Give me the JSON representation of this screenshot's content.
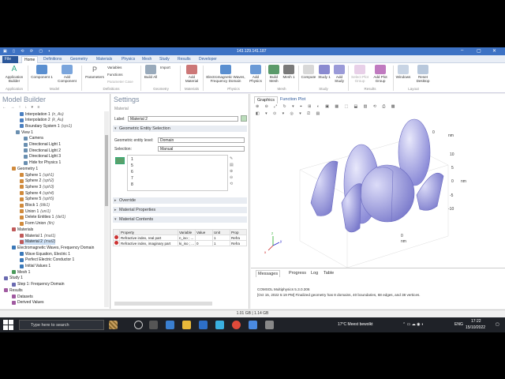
{
  "titlebar": {
    "title": "143.129.141.187"
  },
  "menu_tabs": [
    "File",
    "Home",
    "Definitions",
    "Geometry",
    "Materials",
    "Physics",
    "Mesh",
    "Study",
    "Results",
    "Developer"
  ],
  "ribbon": {
    "buttons": [
      "Application Builder",
      "Component 1",
      "Add Component",
      "Parameters",
      "Build All",
      "Add Material",
      "Electromagnetic Waves, Frequency Domain",
      "Add Physics",
      "Build Mesh",
      "Mesh 1",
      "Compute",
      "Study 1",
      "Add Study",
      "Select Plot Group",
      "Add Plot Group",
      "Windows",
      "Reset Desktop"
    ],
    "small": [
      "Variables",
      "Functions",
      "Parameter Case",
      "Import"
    ],
    "groups": [
      "Application",
      "Model",
      "Definitions",
      "Geometry",
      "Materials",
      "Physics",
      "Mesh",
      "Study",
      "Results",
      "Layout"
    ]
  },
  "model_builder": {
    "title": "Model Builder",
    "tree": [
      {
        "label": "Interpolation 1",
        "tag": "(n_Au)",
        "indent": 5,
        "color": "#4a7fc0"
      },
      {
        "label": "Interpolation 2",
        "tag": "(k_Au)",
        "indent": 5,
        "color": "#4a7fc0"
      },
      {
        "label": "Boundary System 1",
        "tag": "(sys1)",
        "indent": 5,
        "color": "#4a7fc0"
      },
      {
        "label": "View 1",
        "tag": "",
        "indent": 4,
        "color": "#6a8fb0"
      },
      {
        "label": "Camera",
        "tag": "",
        "indent": 6,
        "color": "#6a8fb0"
      },
      {
        "label": "Directional Light 1",
        "tag": "",
        "indent": 6,
        "color": "#6a8fb0"
      },
      {
        "label": "Directional Light 2",
        "tag": "",
        "indent": 6,
        "color": "#6a8fb0"
      },
      {
        "label": "Directional Light 3",
        "tag": "",
        "indent": 6,
        "color": "#6a8fb0"
      },
      {
        "label": "Hide for Physics 1",
        "tag": "",
        "indent": 6,
        "color": "#6a8fb0"
      },
      {
        "label": "Geometry 1",
        "tag": "",
        "indent": 3,
        "color": "#d08a3c"
      },
      {
        "label": "Sphere 1",
        "tag": "(sph1)",
        "indent": 5,
        "color": "#d08a3c"
      },
      {
        "label": "Sphere 2",
        "tag": "(sph2)",
        "indent": 5,
        "color": "#d08a3c"
      },
      {
        "label": "Sphere 3",
        "tag": "(sph3)",
        "indent": 5,
        "color": "#d08a3c"
      },
      {
        "label": "Sphere 4",
        "tag": "(sph4)",
        "indent": 5,
        "color": "#d08a3c"
      },
      {
        "label": "Sphere 5",
        "tag": "(sph5)",
        "indent": 5,
        "color": "#d08a3c"
      },
      {
        "label": "Block 1",
        "tag": "(blk1)",
        "indent": 5,
        "color": "#d08a3c"
      },
      {
        "label": "Union 1",
        "tag": "(uni1)",
        "indent": 5,
        "color": "#d08a3c"
      },
      {
        "label": "Delete Entities 1",
        "tag": "(del1)",
        "indent": 5,
        "color": "#d08a3c"
      },
      {
        "label": "Form Union",
        "tag": "(fin)",
        "indent": 5,
        "color": "#d08a3c"
      },
      {
        "label": "Materials",
        "tag": "",
        "indent": 3,
        "color": "#c05a5a"
      },
      {
        "label": "Material 1",
        "tag": "(mat1)",
        "indent": 5,
        "color": "#c05a5a"
      },
      {
        "label": "Material 2",
        "tag": "(mat2)",
        "indent": 5,
        "color": "#c05a5a",
        "selected": true
      },
      {
        "label": "Electromagnetic Waves, Frequency Domain",
        "tag": "",
        "indent": 3,
        "color": "#3a78b8"
      },
      {
        "label": "Wave Equation, Electric 1",
        "tag": "",
        "indent": 5,
        "color": "#3a78b8"
      },
      {
        "label": "Perfect Electric Conductor 1",
        "tag": "",
        "indent": 5,
        "color": "#3a78b8"
      },
      {
        "label": "Initial Values 1",
        "tag": "",
        "indent": 5,
        "color": "#3a78b8"
      },
      {
        "label": "Mesh 1",
        "tag": "",
        "indent": 3,
        "color": "#4a9a5a"
      },
      {
        "label": "Study 1",
        "tag": "",
        "indent": 1,
        "color": "#6a6ab0"
      },
      {
        "label": "Step 1: Frequency Domain",
        "tag": "",
        "indent": 3,
        "color": "#6a6ab0"
      },
      {
        "label": "Results",
        "tag": "",
        "indent": 1,
        "color": "#a05aa0"
      },
      {
        "label": "Datasets",
        "tag": "",
        "indent": 3,
        "color": "#a05aa0"
      },
      {
        "label": "Derived Values",
        "tag": "",
        "indent": 3,
        "color": "#a05aa0"
      }
    ]
  },
  "settings": {
    "title": "Settings",
    "subtitle": "Material",
    "label_caption": "Label:",
    "label_value": "Material 2",
    "section_ges": "Geometric Entity Selection",
    "entity_level_caption": "Geometric entity level:",
    "entity_level_value": "Domain",
    "selection_caption": "Selection:",
    "selection_value": "Manual",
    "selection_items": [
      "1",
      "5",
      "6",
      "7",
      "8"
    ],
    "section_override": "Override",
    "section_mat_props": "Material Properties",
    "section_mat_contents": "Material Contents",
    "table_headers": [
      "",
      "Property",
      "Variable",
      "Value",
      "Unit",
      "Prop"
    ],
    "table_rows": [
      [
        "Refractive index, real part",
        "n_iso ; ...",
        "",
        "1",
        "Refra"
      ],
      [
        "Refractive index, imaginary part",
        "ki_iso ; ...",
        "0",
        "1",
        "Refra"
      ]
    ]
  },
  "graphics": {
    "tabs": [
      "Graphics",
      "Function Plot"
    ],
    "axis_labels": [
      "nm",
      "nm",
      "nm"
    ],
    "ticks_z": [
      "10",
      "5",
      "0",
      "-5",
      "-10"
    ],
    "ticks_x": [
      "0"
    ],
    "ticks_x2": [
      "0"
    ],
    "triad": [
      "z",
      "y",
      "x"
    ]
  },
  "messages": {
    "tabs": [
      "Messages",
      "Progress",
      "Log",
      "Table"
    ],
    "lines": [
      "COMSOL Multiphysics 5.3.0.306",
      "[Oct 15, 2022 5:19 PM] Finalized geometry has 8 domains, 40 boundaries, 68 edges, and 38 vertices."
    ]
  },
  "status": {
    "memory": "1.01 GB | 1.14 GB"
  },
  "taskbar": {
    "search_placeholder": "Type here to search",
    "weather": "17°C  Meest bewolkt",
    "lang": "ENG",
    "time": "17:22",
    "date": "15/10/2022"
  }
}
